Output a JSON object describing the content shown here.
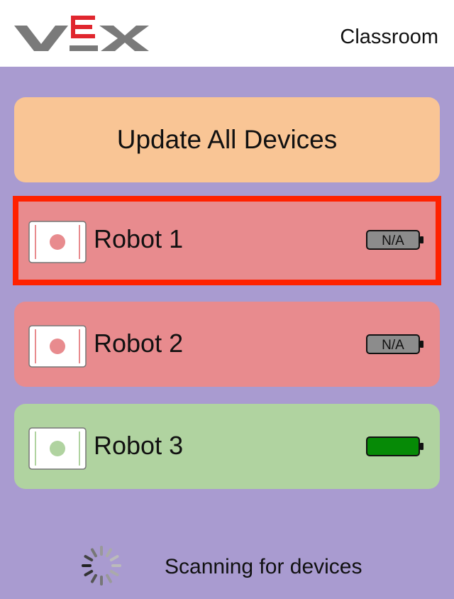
{
  "header": {
    "brand": "VEX",
    "title": "Classroom"
  },
  "update_button": {
    "label": "Update All Devices"
  },
  "devices": [
    {
      "name": "Robot 1",
      "battery": "N/A",
      "status": "red",
      "selected": true
    },
    {
      "name": "Robot 2",
      "battery": "N/A",
      "status": "red",
      "selected": false
    },
    {
      "name": "Robot 3",
      "battery": "",
      "status": "green",
      "selected": false
    }
  ],
  "status": {
    "scanning_text": "Scanning for devices"
  },
  "colors": {
    "background": "#a99bd0",
    "update_button": "#f9c595",
    "device_red": "#e88b8e",
    "device_green": "#b0d3a0",
    "selection_border": "#ff2100",
    "battery_full": "#068a06",
    "logo_red": "#e0262e",
    "logo_gray": "#7a7a7a"
  },
  "icons": {
    "logo": "vex-logo",
    "robot": "robot-brain-icon",
    "battery": "battery-icon",
    "spinner": "loading-spinner-icon"
  }
}
